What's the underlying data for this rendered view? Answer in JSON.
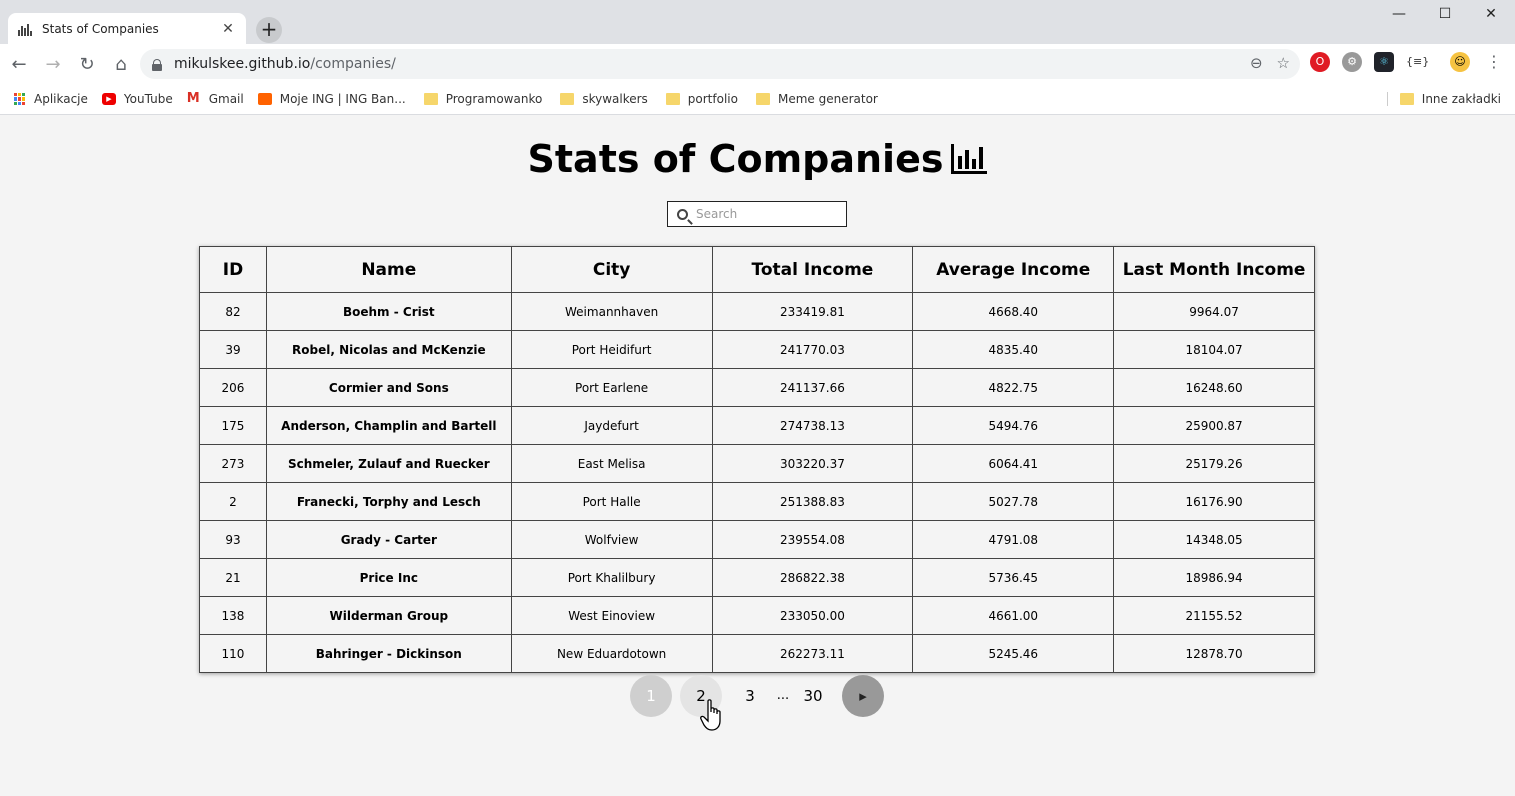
{
  "browser": {
    "tab_title": "Stats of Companies",
    "url_host": "mikulskee.github.io",
    "url_path": "/companies/",
    "bookmarks": [
      {
        "label": "Aplikacje",
        "icon": "apps-icon"
      },
      {
        "label": "YouTube",
        "icon": "youtube-icon"
      },
      {
        "label": "Gmail",
        "icon": "gmail-icon"
      },
      {
        "label": "Moje ING | ING Ban...",
        "icon": "ing-icon"
      },
      {
        "label": "Programowanko",
        "icon": "folder-icon"
      },
      {
        "label": "skywalkers",
        "icon": "folder-icon"
      },
      {
        "label": "portfolio",
        "icon": "folder-icon"
      },
      {
        "label": "Meme generator",
        "icon": "folder-icon"
      }
    ],
    "other_bookmarks": "Inne zakładki"
  },
  "page": {
    "title": "Stats of Companies",
    "search_placeholder": "Search"
  },
  "table": {
    "columns": [
      "ID",
      "Name",
      "City",
      "Total Income",
      "Average Income",
      "Last Month Income"
    ],
    "rows": [
      [
        "82",
        "Boehm - Crist",
        "Weimannhaven",
        "233419.81",
        "4668.40",
        "9964.07"
      ],
      [
        "39",
        "Robel, Nicolas and McKenzie",
        "Port Heidifurt",
        "241770.03",
        "4835.40",
        "18104.07"
      ],
      [
        "206",
        "Cormier and Sons",
        "Port Earlene",
        "241137.66",
        "4822.75",
        "16248.60"
      ],
      [
        "175",
        "Anderson, Champlin and Bartell",
        "Jaydefurt",
        "274738.13",
        "5494.76",
        "25900.87"
      ],
      [
        "273",
        "Schmeler, Zulauf and Ruecker",
        "East Melisa",
        "303220.37",
        "6064.41",
        "25179.26"
      ],
      [
        "2",
        "Franecki, Torphy and Lesch",
        "Port Halle",
        "251388.83",
        "5027.78",
        "16176.90"
      ],
      [
        "93",
        "Grady - Carter",
        "Wolfview",
        "239554.08",
        "4791.08",
        "14348.05"
      ],
      [
        "21",
        "Price Inc",
        "Port Khalilbury",
        "286822.38",
        "5736.45",
        "18986.94"
      ],
      [
        "138",
        "Wilderman Group",
        "West Einoview",
        "233050.00",
        "4661.00",
        "21155.52"
      ],
      [
        "110",
        "Bahringer - Dickinson",
        "New Eduardotown",
        "262273.11",
        "5245.46",
        "12878.70"
      ]
    ]
  },
  "pagination": {
    "pages": [
      "1",
      "2",
      "3"
    ],
    "ellipsis": "...",
    "last": "30",
    "current": "1"
  }
}
